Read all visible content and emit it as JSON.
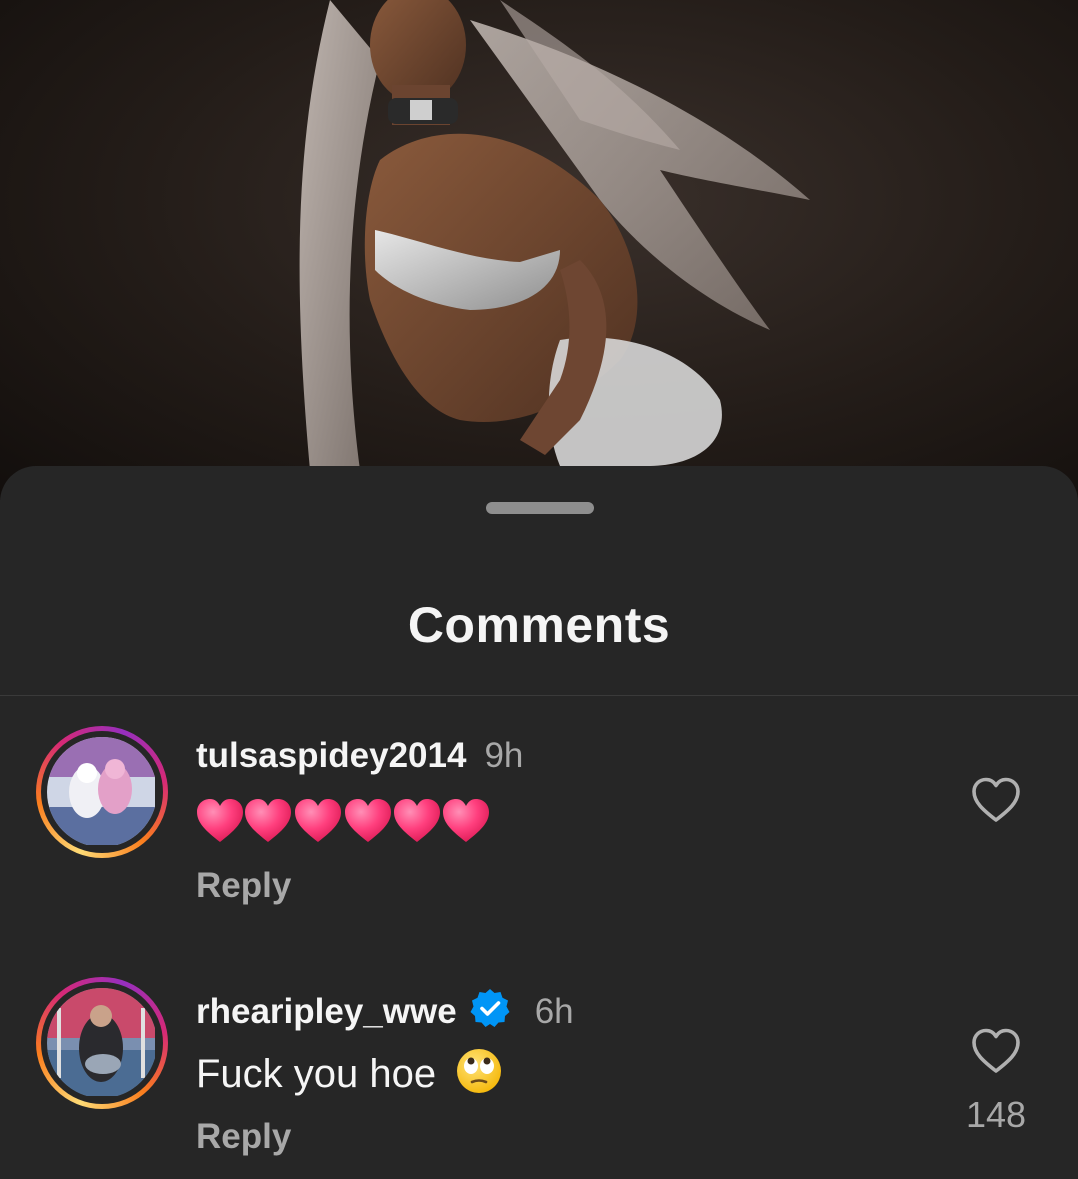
{
  "sheet": {
    "title": "Comments"
  },
  "comments": [
    {
      "username": "tulsaspidey2014",
      "time": "9h",
      "text": "",
      "emoji": "pink-hearts-x6",
      "reply_label": "Reply",
      "verified": false,
      "like_count": ""
    },
    {
      "username": "rhearipley_wwe",
      "time": "6h",
      "text": "Fuck you hoe",
      "emoji": "face-with-rolling-eyes",
      "reply_label": "Reply",
      "verified": true,
      "like_count": "148"
    }
  ],
  "colors": {
    "background": "#262626",
    "text_primary": "#f5f5f5",
    "text_secondary": "#a8a8a8",
    "verified_blue": "#0095f6",
    "heart_pink": "#ff2d6f"
  },
  "icons": [
    "heart-outline-icon",
    "verified-badge-icon",
    "drag-handle"
  ]
}
